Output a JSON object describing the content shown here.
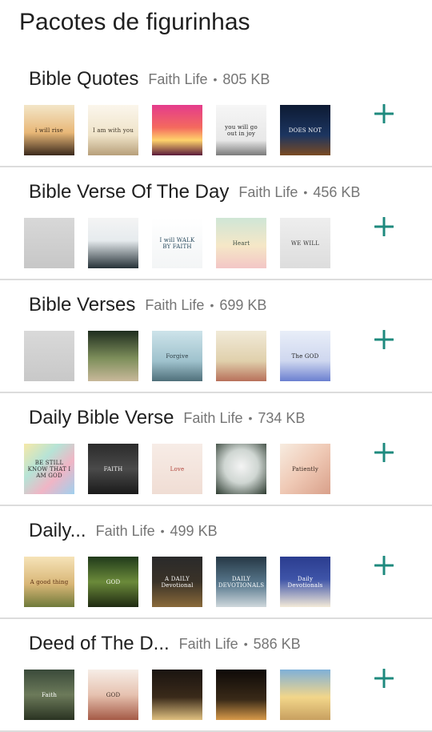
{
  "page_title": "Pacotes de figurinhas",
  "accent_color": "#1e8a7e",
  "packs": [
    {
      "name": "Bible Quotes",
      "publisher": "Faith Life",
      "size": "805 KB",
      "add_icon": "plus-icon",
      "thumbs": [
        {
          "bg": "linear-gradient(180deg,#f3e6c8 0%,#e8b777 55%,#3b2a1c 100%)",
          "fg": "#3a2a1a",
          "text": "i will rise"
        },
        {
          "bg": "linear-gradient(180deg,#fbf6ec 0%,#efe3c8 60%,#b79f7a 100%)",
          "fg": "#3d3324",
          "text": "I am with you"
        },
        {
          "bg": "linear-gradient(180deg,#e43b8c 0%,#f46a5e 45%,#ffd36b 70%,#5a1a3a 100%)",
          "fg": "#ffffff",
          "text": ""
        },
        {
          "bg": "linear-gradient(180deg,#f6f6f6 0%,#e8e8e8 70%,#7a7a7a 100%)",
          "fg": "#222222",
          "text": "you will go out in joy"
        },
        {
          "bg": "linear-gradient(180deg,#0d1a33 0%,#1c3560 60%,#7a4a22 100%)",
          "fg": "#ffffff",
          "text": "DOES NOT"
        }
      ]
    },
    {
      "name": "Bible Verse Of The Day",
      "publisher": "Faith Life",
      "size": "456 KB",
      "add_icon": "plus-icon",
      "thumbs": [
        {
          "bg": "linear-gradient(180deg,#d8d8d8 0%,#c7c7c7 100%)",
          "fg": "#3a3a3a",
          "text": ""
        },
        {
          "bg": "linear-gradient(180deg,#f4f4f4 0%,#e6ebee 45%,#263238 100%)",
          "fg": "#2a2a2a",
          "text": ""
        },
        {
          "bg": "linear-gradient(180deg,#ffffff 0%,#f3f5f6 100%)",
          "fg": "#24465a",
          "text": "I will WALK BY FAITH"
        },
        {
          "bg": "linear-gradient(180deg,#cfe6d6 0%,#f5e7c7 55%,#f3c6c6 100%)",
          "fg": "#3a4a3f",
          "text": "Heart"
        },
        {
          "bg": "linear-gradient(180deg,#eeeeee 0%,#dddddd 100%)",
          "fg": "#333333",
          "text": "WE WILL"
        }
      ]
    },
    {
      "name": "Bible Verses",
      "publisher": "Faith Life",
      "size": "699 KB",
      "add_icon": "plus-icon",
      "thumbs": [
        {
          "bg": "linear-gradient(180deg,#d9d9d9 0%,#c8c8c8 100%)",
          "fg": "#3a3a3a",
          "text": ""
        },
        {
          "bg": "linear-gradient(180deg,#1f2d1f 0%,#7e8f5b 55%,#c8b89a 100%)",
          "fg": "#ffffff",
          "text": ""
        },
        {
          "bg": "linear-gradient(180deg,#cde3ea 0%,#9fc2cd 60%,#4f6f7a 100%)",
          "fg": "#2d3d43",
          "text": "Forgive"
        },
        {
          "bg": "linear-gradient(180deg,#f1ead8 0%,#e0d0ac 60%,#b8705a 100%)",
          "fg": "#4a3a2a",
          "text": ""
        },
        {
          "bg": "linear-gradient(180deg,#e8eef8 0%,#cfd7ef 60%,#6a7fd0 100%)",
          "fg": "#222222",
          "text": "The GOD"
        }
      ]
    },
    {
      "name": "Daily Bible Verse",
      "publisher": "Faith Life",
      "size": "734 KB",
      "add_icon": "plus-icon",
      "thumbs": [
        {
          "bg": "linear-gradient(135deg,#f6e9a8 0%,#b6e3d6 35%,#f0b5c5 65%,#9fd0ee 100%)",
          "fg": "#2a2a2a",
          "text": "BE STILL KNOW THAT I AM GOD"
        },
        {
          "bg": "linear-gradient(180deg,#2b2b2b 0%,#4a4a4a 50%,#1a1a1a 100%)",
          "fg": "#f0f0f0",
          "text": "FAITH"
        },
        {
          "bg": "linear-gradient(180deg,#f7ece6 0%,#f0ddd4 100%)",
          "fg": "#b0433a",
          "text": "Love"
        },
        {
          "bg": "radial-gradient(circle at 50% 45%,#f4f4f4 0%,#cfd6d2 45%,#2c3a2f 100%)",
          "fg": "#333333",
          "text": ""
        },
        {
          "bg": "linear-gradient(135deg,#f7ece0 0%,#efc9b5 50%,#d9a08a 100%)",
          "fg": "#3a2a22",
          "text": "Patiently"
        }
      ]
    },
    {
      "name": "Daily...",
      "publisher": "Faith Life",
      "size": "499 KB",
      "add_icon": "plus-icon",
      "thumbs": [
        {
          "bg": "linear-gradient(180deg,#f6e3b8 0%,#d8b676 55%,#6f7a3a 100%)",
          "fg": "#5a2f12",
          "text": "A good thing"
        },
        {
          "bg": "linear-gradient(180deg,#203a1a 0%,#6b8a3a 50%,#1f2a12 100%)",
          "fg": "#ffffff",
          "text": "GOD"
        },
        {
          "bg": "linear-gradient(180deg,#2a2a2a 0%,#3a3228 50%,#8a6a3a 100%)",
          "fg": "#ffffff",
          "text": "A DAILY Devotional"
        },
        {
          "bg": "linear-gradient(180deg,#263845 0%,#5a7a8f 55%,#cfd8dc 100%)",
          "fg": "#ffffff",
          "text": "DAILY DEVOTIONALS"
        },
        {
          "bg": "linear-gradient(180deg,#2b3d8f 0%,#3e54a8 45%,#f3ead8 100%)",
          "fg": "#ffffff",
          "text": "Daily Devotionals"
        }
      ]
    },
    {
      "name": "Deed of The D...",
      "publisher": "Faith Life",
      "size": "586 KB",
      "add_icon": "plus-icon",
      "thumbs": [
        {
          "bg": "linear-gradient(180deg,#3a4a3a 0%,#6c7a5a 50%,#2a3322 100%)",
          "fg": "#ffffff",
          "text": "Faith"
        },
        {
          "bg": "linear-gradient(180deg,#f6ede6 0%,#e6c2b0 50%,#a55a46 100%)",
          "fg": "#3a2a22",
          "text": "GOD"
        },
        {
          "bg": "linear-gradient(180deg,#1a1410 0%,#3a2a1a 55%,#e0c080 100%)",
          "fg": "#ffffff",
          "text": ""
        },
        {
          "bg": "linear-gradient(180deg,#0e0a08 0%,#3a2a18 60%,#d89a4a 100%)",
          "fg": "#ffffff",
          "text": ""
        },
        {
          "bg": "linear-gradient(180deg,#7fb0d8 0%,#f2d68a 55%,#c8a060 100%)",
          "fg": "#1a1a1a",
          "text": ""
        }
      ]
    }
  ]
}
